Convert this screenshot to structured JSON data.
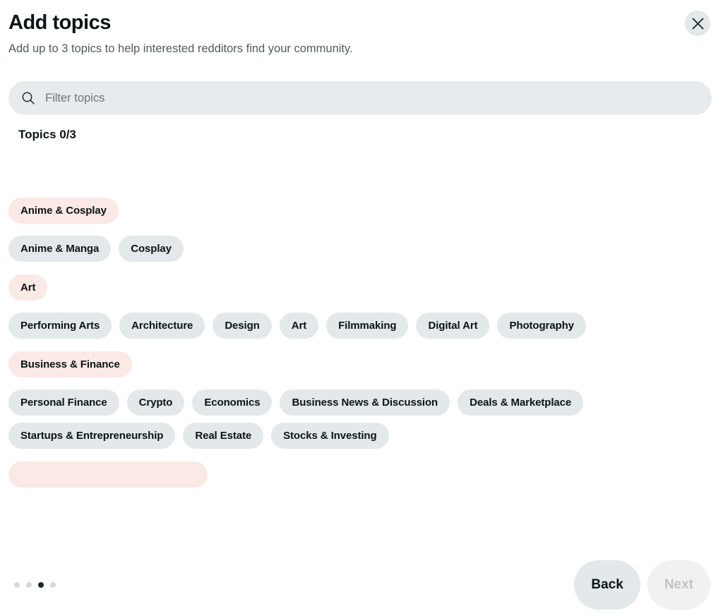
{
  "header": {
    "title": "Add topics",
    "subtitle": "Add up to 3 topics to help interested redditors find your community.",
    "close_icon": "close-icon"
  },
  "search": {
    "icon": "search-icon",
    "placeholder": "Filter topics",
    "value": ""
  },
  "counter": {
    "label": "Topics 0/3",
    "selected": 0,
    "max": 3
  },
  "groups": [
    {
      "category": "Anime & Cosplay",
      "topics": [
        "Anime & Manga",
        "Cosplay"
      ]
    },
    {
      "category": "Art",
      "topics": [
        "Performing Arts",
        "Architecture",
        "Design",
        "Art",
        "Filmmaking",
        "Digital Art",
        "Photography"
      ]
    },
    {
      "category": "Business & Finance",
      "topics": [
        "Personal Finance",
        "Crypto",
        "Economics",
        "Business News & Discussion",
        "Deals & Marketplace",
        "Startups & Entrepreneurship",
        "Real Estate",
        "Stocks & Investing"
      ]
    }
  ],
  "footer": {
    "dots": {
      "count": 4,
      "active_index": 2
    },
    "back_label": "Back",
    "next_label": "Next",
    "next_disabled": true
  },
  "colors": {
    "category_chip_bg": "#fbe9e5",
    "topic_chip_bg": "#e3e8ea",
    "search_bg": "#e7ebee",
    "text_primary": "#0b1416",
    "text_secondary": "#4f5b5d",
    "dot_active": "#1b2a2e",
    "dot_inactive": "#d5dade",
    "next_disabled_text": "#c3c3c3",
    "next_disabled_bg": "#f1f1f1"
  }
}
